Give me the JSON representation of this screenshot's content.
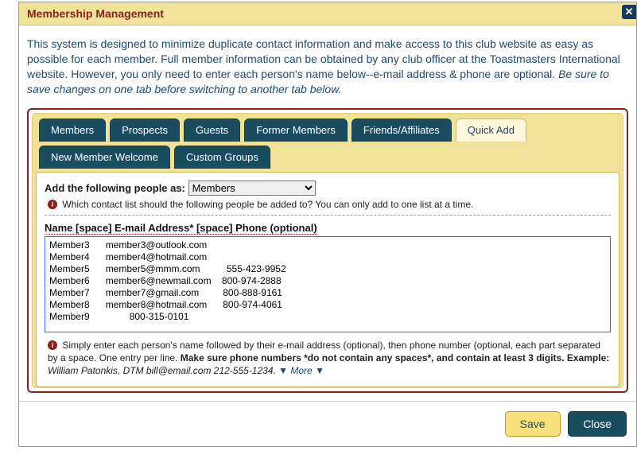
{
  "title": "Membership Management",
  "intro": {
    "text": "This system is designed to minimize duplicate contact information and make access to this club website as easy as possible for each member. Full member information can be obtained by any club officer at the Toastmasters International website. However, you only need to enter each person's name below--e-mail address & phone are optional. ",
    "italic": "Be sure to save changes on one tab before switching to another tab below."
  },
  "tabs": [
    "Members",
    "Prospects",
    "Guests",
    "Former Members",
    "Friends/Affiliates",
    "Quick Add",
    "New Member Welcome",
    "Custom Groups"
  ],
  "active_tab": "Quick Add",
  "add_as": {
    "label": "Add the following people as:",
    "selected": "Members",
    "help": "Which contact list should the following people be added to? You can only add to one list at a time."
  },
  "field_label": "Name [space] E-mail Address* [space] Phone (optional)",
  "textarea_value": "Member3      member3@outlook.com\nMember4      member4@hotmail.com\nMember5      member5@mmm.com          555-423-9952\nMember6      member6@newmail.com    800-974-2888\nMember7      member7@gmail.com         800-888-9161\nMember8      member8@hotmail.com      800-974-4061\nMember9               800-315-0101\n",
  "help2": {
    "part1": "Simply enter each person's name followed by their e-mail address (optional), then phone number (optional, each part separated by a space. One entry per line. ",
    "bold": "Make sure phone numbers *do not contain any spaces*, and contain at least 3 digits. Example: ",
    "example": "William Patonkis, DTM bill@email.com 212-555-1234.",
    "more": " ▼ More ▼"
  },
  "buttons": {
    "save": "Save",
    "close": "Close"
  }
}
